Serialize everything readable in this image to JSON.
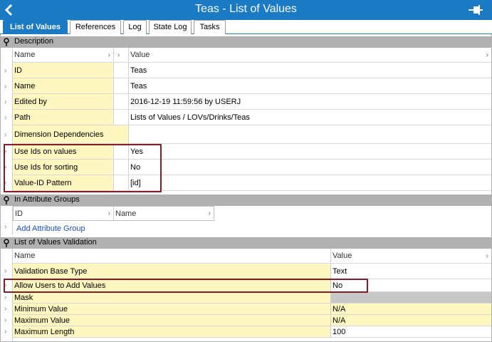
{
  "window": {
    "title": "Teas - List of Values"
  },
  "icons": {
    "back": "back-arrow-icon",
    "pin": "pin-icon",
    "section_pin": "section-pin-icon",
    "row_expand": "chevron-right-icon"
  },
  "colors": {
    "titlebar": "#1a7ac4",
    "name_cell": "#fff6c0",
    "section_header": "#b0b0b0",
    "highlight": "#8b1a24"
  },
  "tabs": [
    {
      "label": "List of Values",
      "active": true
    },
    {
      "label": "References",
      "active": false
    },
    {
      "label": "Log",
      "active": false
    },
    {
      "label": "State Log",
      "active": false
    },
    {
      "label": "Tasks",
      "active": false
    }
  ],
  "description": {
    "header": "Description",
    "col_name": "Name",
    "col_value": "Value",
    "rows": [
      {
        "name": "ID",
        "value": "Teas"
      },
      {
        "name": "Name",
        "value": "Teas"
      },
      {
        "name": "Edited by",
        "value": "2016-12-19 11:59:56 by USERJ"
      },
      {
        "name": "Path",
        "value": "Lists of Values / LOVs/Drinks/Teas"
      },
      {
        "name": "Dimension Dependencies",
        "value": ""
      },
      {
        "name": "Use Ids on values",
        "value": "Yes"
      },
      {
        "name": "Use Ids for sorting",
        "value": "No"
      },
      {
        "name": "Value-ID Pattern",
        "value": "[id]"
      }
    ]
  },
  "attribute_groups": {
    "header": "In Attribute Groups",
    "col_id": "ID",
    "col_name": "Name",
    "add_link": "Add Attribute Group"
  },
  "lov_validation": {
    "header": "List of Values Validation",
    "col_name": "Name",
    "col_value": "Value",
    "rows": [
      {
        "name": "Validation Base Type",
        "value": "Text"
      },
      {
        "name": "Allow Users to Add Values",
        "value": "No"
      },
      {
        "name": "Mask",
        "value": ""
      },
      {
        "name": "Minimum Value",
        "value": "N/A"
      },
      {
        "name": "Maximum Value",
        "value": "N/A"
      },
      {
        "name": "Maximum Length",
        "value": "100"
      }
    ]
  }
}
